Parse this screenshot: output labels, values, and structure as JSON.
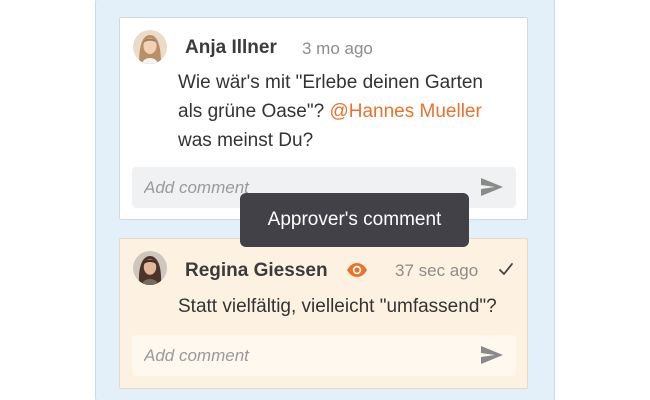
{
  "comments": [
    {
      "author": "Anja Illner",
      "time": "3 mo ago",
      "text_before": "Wie wär's mit \"Erlebe deinen Garten als grüne Oase\"? ",
      "mention": "@Hannes Mueller",
      "text_after": " was meinst Du?",
      "reply_placeholder": "Add comment"
    },
    {
      "author": "Regina Giessen",
      "time": "37 sec ago",
      "text": "Statt vielfältig, vielleicht \"umfassend\"?",
      "reply_placeholder": "Add comment",
      "approver_icon": "eye-icon",
      "status_icon": "check-icon"
    }
  ],
  "tooltip": {
    "text": "Approver's comment"
  },
  "colors": {
    "panel": "#e4f0f9",
    "mention": "#e8732c",
    "approver_card": "#fdf2e2",
    "tooltip": "#414147"
  }
}
